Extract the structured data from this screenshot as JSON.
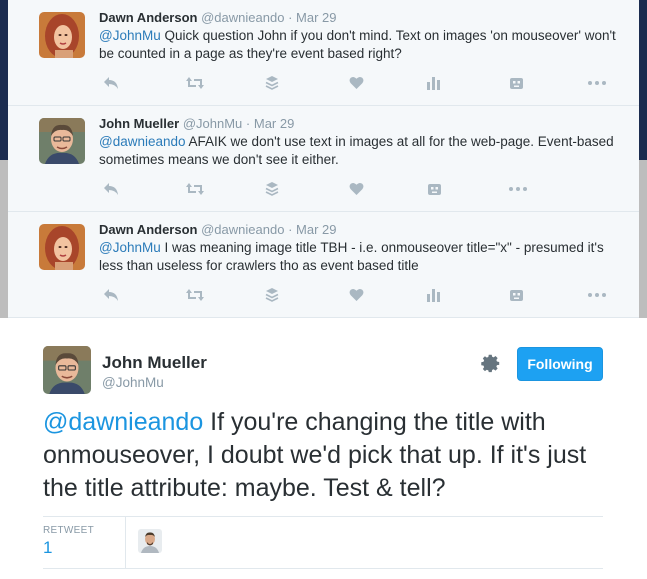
{
  "replies": [
    {
      "name": "Dawn Anderson",
      "handle": "@dawnieando",
      "separator": "·",
      "date": "Mar 29",
      "mention": "@JohnMu",
      "text": " Quick question John if you don't mind.  Text on images 'on mouseover' won't be counted in a page as they're event based right?",
      "avatar_icon": "woman-avatar"
    },
    {
      "name": "John Mueller",
      "handle": "@JohnMu",
      "separator": "·",
      "date": "Mar 29",
      "mention": "@dawnieando",
      "text": " AFAIK we don't use text in images at all for the web-page. Event-based sometimes means we don't see it either.",
      "avatar_icon": "man-avatar"
    },
    {
      "name": "Dawn Anderson",
      "handle": "@dawnieando",
      "separator": "·",
      "date": "Mar 29",
      "mention": "@JohnMu",
      "text": " I was meaning image title TBH - i.e. onmouseover title=\"x\" - presumed it's less than useless for crawlers tho as event based title",
      "avatar_icon": "woman-avatar"
    }
  ],
  "main_tweet": {
    "name": "John Mueller",
    "handle": "@JohnMu",
    "follow_label": "Following",
    "mention": "@dawnieando",
    "text": " If you're changing the title with onmouseover, I doubt we'd pick that up. If it's just the title attribute: maybe. Test & tell?",
    "retweet_label": "RETWEET",
    "retweet_count": "1"
  },
  "icons": {
    "reply": "reply-icon",
    "retweet": "retweet-icon",
    "buffer": "buffer-stack-icon",
    "like": "heart-icon",
    "analytics": "analytics-bars-icon",
    "bot": "robot-icon",
    "more": "more-dots-icon",
    "settings": "gear-icon"
  },
  "colors": {
    "link": "#1b95e0",
    "button": "#1da1f2",
    "muted": "#8899a6",
    "icon": "#aab8c2",
    "reply_background": "#f5f8fa"
  }
}
